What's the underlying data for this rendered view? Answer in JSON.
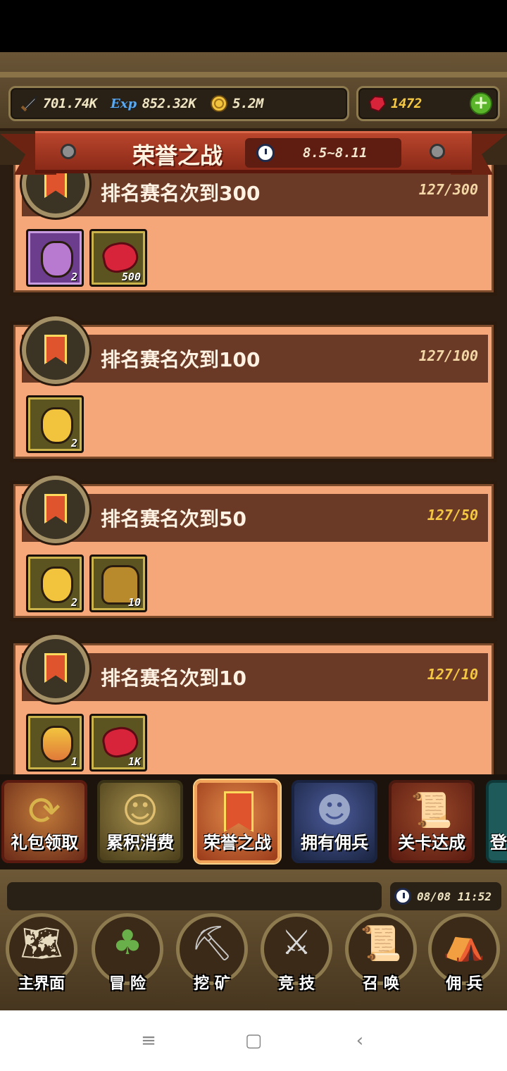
{
  "resources": {
    "attack": "701.74K",
    "exp": "852.32K",
    "gold": "5.2M",
    "gems": "1472",
    "exp_icon_label": "Exp",
    "plus": "+"
  },
  "banner": {
    "title": "荣誉之战",
    "dates": "8.5~8.11"
  },
  "missions": [
    {
      "title": "排名赛名次到300",
      "progress": "127/300",
      "progress_color": "#f3d7a6",
      "rewards": [
        {
          "type": "purple-bag",
          "count": "2"
        },
        {
          "type": "ruby",
          "count": "500"
        }
      ]
    },
    {
      "title": "排名赛名次到100",
      "progress": "127/100",
      "progress_color": "#f3d7a6",
      "rewards": [
        {
          "type": "gold-bag",
          "count": "2"
        }
      ]
    },
    {
      "title": "排名赛名次到50",
      "progress": "127/50",
      "progress_color": "#f4c842",
      "rewards": [
        {
          "type": "gold-bag",
          "count": "2"
        },
        {
          "type": "golem",
          "count": "10"
        }
      ]
    },
    {
      "title": "排名赛名次到10",
      "progress": "127/10",
      "progress_color": "#f4c842",
      "rewards": [
        {
          "type": "mixed-bag",
          "count": "1"
        },
        {
          "type": "ruby",
          "count": "1K"
        }
      ]
    }
  ],
  "tabs": [
    {
      "label": "礼包领取",
      "color": "#8a4a2a"
    },
    {
      "label": "累积消费",
      "color": "#6b5a2c"
    },
    {
      "label": "荣誉之战",
      "color": "#b4532c",
      "active": true
    },
    {
      "label": "拥有佣兵",
      "color": "#2c3d6b"
    },
    {
      "label": "关卡达成",
      "color": "#7a3a2a"
    },
    {
      "label": "登",
      "color": "#1f5a5a"
    }
  ],
  "nav": {
    "time": "08/08 11:52",
    "items": [
      {
        "label": "主界面",
        "icon": "map-scroll-icon"
      },
      {
        "label": "冒 险",
        "icon": "island-icon"
      },
      {
        "label": "挖 矿",
        "icon": "pickaxe-icon"
      },
      {
        "label": "竞 技",
        "icon": "crossed-swords-icon"
      },
      {
        "label": "召 唤",
        "icon": "summon-scroll-icon"
      },
      {
        "label": "佣 兵",
        "icon": "tent-icon"
      }
    ]
  },
  "android": {
    "menu": "≡",
    "home": "▢",
    "back": "‹"
  }
}
